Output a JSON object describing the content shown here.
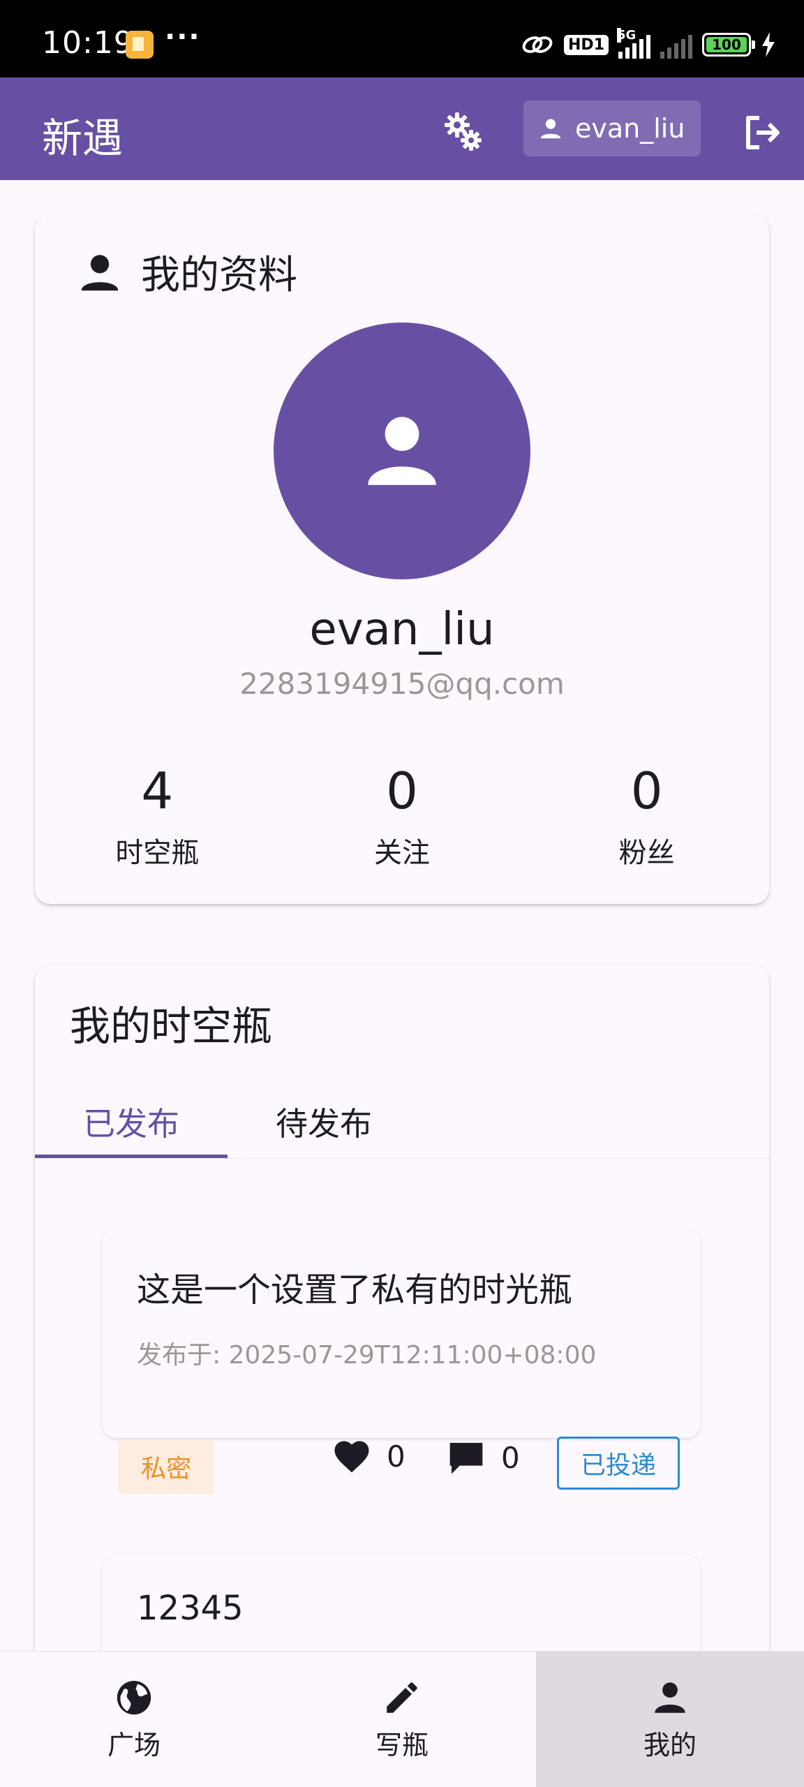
{
  "status_bar": {
    "time": "10:19",
    "dots": "···",
    "hd_label": "HD1",
    "network": "5G",
    "battery": "100"
  },
  "app_bar": {
    "title": "新遇",
    "username": "evan_liu",
    "color": "#6750a4"
  },
  "profile": {
    "section_title": "我的资料",
    "name": "evan_liu",
    "email": "2283194915@qq.com",
    "stats": [
      {
        "value": "4",
        "label": "时空瓶"
      },
      {
        "value": "0",
        "label": "关注"
      },
      {
        "value": "0",
        "label": "粉丝"
      }
    ]
  },
  "bottles": {
    "section_title": "我的时空瓶",
    "tabs": [
      {
        "label": "已发布",
        "active": true
      },
      {
        "label": "待发布",
        "active": false
      }
    ],
    "items": [
      {
        "text": "这是一个设置了私有的时光瓶",
        "date": "发布于: 2025-07-29T12:11:00+08:00",
        "privacy": "私密",
        "likes": "0",
        "comments": "0",
        "status": "已投递"
      },
      {
        "text": "12345"
      }
    ]
  },
  "bottom_nav": [
    {
      "label": "广场",
      "icon": "globe-icon"
    },
    {
      "label": "写瓶",
      "icon": "pencil-icon"
    },
    {
      "label": "我的",
      "icon": "person-icon",
      "active": true
    }
  ]
}
